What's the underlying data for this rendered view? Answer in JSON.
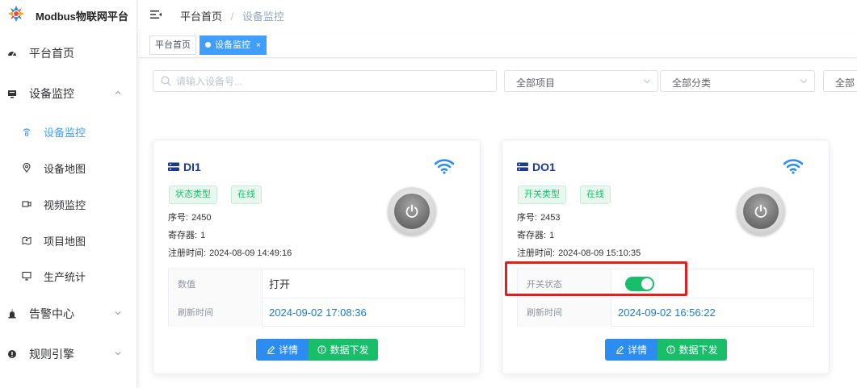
{
  "app": {
    "logo_text": "Modbus物联网平台"
  },
  "sidebar": {
    "items": [
      {
        "label": "平台首页",
        "icon": "dashboard-icon"
      },
      {
        "label": "设备监控",
        "icon": "monitor-icon",
        "expanded": true
      },
      {
        "label": "告警中心",
        "icon": "alarm-icon"
      },
      {
        "label": "规则引擎",
        "icon": "rule-icon"
      }
    ],
    "subitems": [
      {
        "label": "设备监控",
        "icon": "broadcast-icon",
        "active": true
      },
      {
        "label": "设备地图",
        "icon": "location-icon"
      },
      {
        "label": "视频监控",
        "icon": "video-icon"
      },
      {
        "label": "项目地图",
        "icon": "map-icon"
      },
      {
        "label": "生产统计",
        "icon": "computer-icon"
      }
    ]
  },
  "header": {
    "breadcrumb": [
      "平台首页",
      "设备监控"
    ],
    "separator": "/"
  },
  "tags": [
    {
      "label": "平台首页",
      "active": false
    },
    {
      "label": "设备监控",
      "active": true,
      "close": "×"
    }
  ],
  "filters": {
    "search_placeholder": "请输入设备号...",
    "project_select": "全部项目",
    "category_select": "全部分类",
    "third_select": "全部"
  },
  "cards": [
    {
      "name": "DI1",
      "type_badge": "状态类型",
      "status_badge": "在线",
      "serial_label": "序号:",
      "serial": "2450",
      "register_label": "寄存器:",
      "register": "1",
      "reg_time_label": "注册时间:",
      "reg_time": "2024-08-09 14:49:16",
      "row1_label": "数值",
      "row1_value": "打开",
      "row2_label": "刷新时间",
      "row2_value": "2024-09-02 17:08:36",
      "detail_button": "详情",
      "send_button": "数据下发"
    },
    {
      "name": "DO1",
      "type_badge": "开关类型",
      "status_badge": "在线",
      "serial_label": "序号:",
      "serial": "2453",
      "register_label": "寄存器:",
      "register": "1",
      "reg_time_label": "注册时间:",
      "reg_time": "2024-08-09 15:10:35",
      "row1_label": "开关状态",
      "switch_on": true,
      "row2_label": "刷新时间",
      "row2_value": "2024-09-02 16:56:22",
      "detail_button": "详情",
      "send_button": "数据下发"
    }
  ],
  "colors": {
    "primary": "#409eff",
    "success": "#19be6b",
    "button_blue": "#2d8cf0",
    "highlight_red": "#e02020"
  }
}
